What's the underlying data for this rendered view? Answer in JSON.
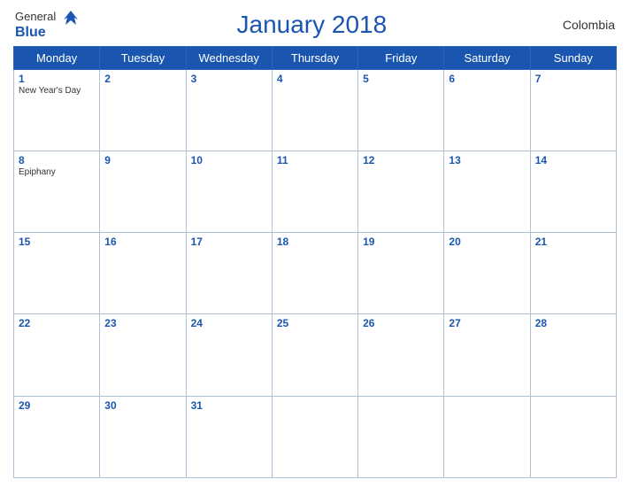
{
  "header": {
    "logo_general": "General",
    "logo_blue": "Blue",
    "title": "January 2018",
    "country": "Colombia"
  },
  "days_of_week": [
    "Monday",
    "Tuesday",
    "Wednesday",
    "Thursday",
    "Friday",
    "Saturday",
    "Sunday"
  ],
  "weeks": [
    [
      {
        "day": 1,
        "holiday": "New Year's Day"
      },
      {
        "day": 2,
        "holiday": ""
      },
      {
        "day": 3,
        "holiday": ""
      },
      {
        "day": 4,
        "holiday": ""
      },
      {
        "day": 5,
        "holiday": ""
      },
      {
        "day": 6,
        "holiday": ""
      },
      {
        "day": 7,
        "holiday": ""
      }
    ],
    [
      {
        "day": 8,
        "holiday": "Epiphany"
      },
      {
        "day": 9,
        "holiday": ""
      },
      {
        "day": 10,
        "holiday": ""
      },
      {
        "day": 11,
        "holiday": ""
      },
      {
        "day": 12,
        "holiday": ""
      },
      {
        "day": 13,
        "holiday": ""
      },
      {
        "day": 14,
        "holiday": ""
      }
    ],
    [
      {
        "day": 15,
        "holiday": ""
      },
      {
        "day": 16,
        "holiday": ""
      },
      {
        "day": 17,
        "holiday": ""
      },
      {
        "day": 18,
        "holiday": ""
      },
      {
        "day": 19,
        "holiday": ""
      },
      {
        "day": 20,
        "holiday": ""
      },
      {
        "day": 21,
        "holiday": ""
      }
    ],
    [
      {
        "day": 22,
        "holiday": ""
      },
      {
        "day": 23,
        "holiday": ""
      },
      {
        "day": 24,
        "holiday": ""
      },
      {
        "day": 25,
        "holiday": ""
      },
      {
        "day": 26,
        "holiday": ""
      },
      {
        "day": 27,
        "holiday": ""
      },
      {
        "day": 28,
        "holiday": ""
      }
    ],
    [
      {
        "day": 29,
        "holiday": ""
      },
      {
        "day": 30,
        "holiday": ""
      },
      {
        "day": 31,
        "holiday": ""
      },
      {
        "day": null,
        "holiday": ""
      },
      {
        "day": null,
        "holiday": ""
      },
      {
        "day": null,
        "holiday": ""
      },
      {
        "day": null,
        "holiday": ""
      }
    ]
  ]
}
